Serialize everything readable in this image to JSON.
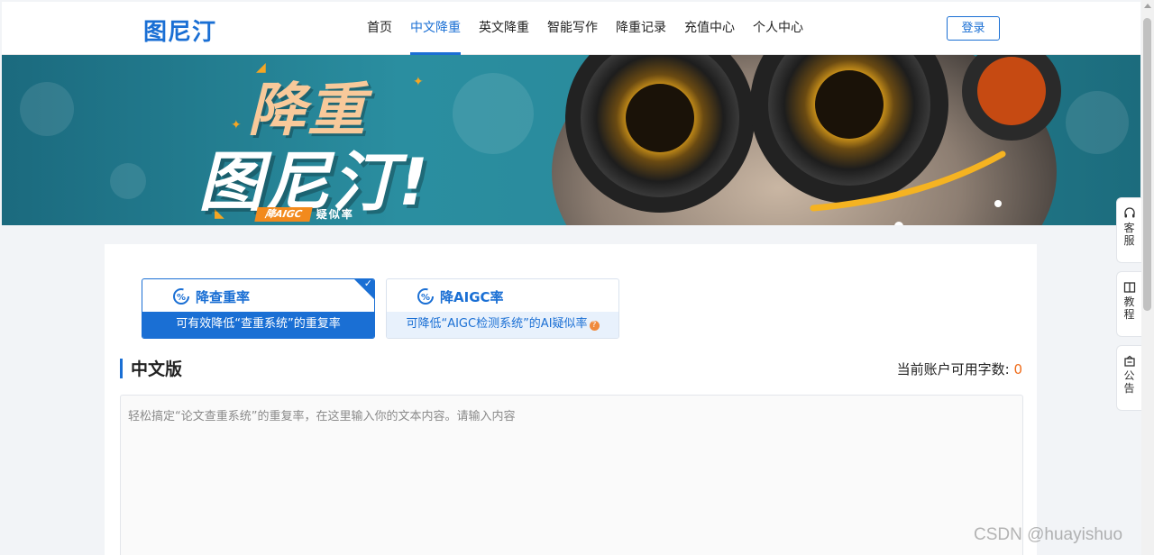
{
  "header": {
    "logo": "图尼汀",
    "nav": [
      {
        "label": "首页",
        "active": false
      },
      {
        "label": "中文降重",
        "active": true
      },
      {
        "label": "英文降重",
        "active": false
      },
      {
        "label": "智能写作",
        "active": false
      },
      {
        "label": "降重记录",
        "active": false
      },
      {
        "label": "充值中心",
        "active": false
      },
      {
        "label": "个人中心",
        "active": false
      }
    ],
    "login_label": "登录"
  },
  "banner": {
    "title_line1": "降重",
    "title_line2": "图尼汀!",
    "tag_pill": "降AIGC",
    "tag_text": "疑似率"
  },
  "mode_tabs": [
    {
      "title": "降查重率",
      "desc": "可有效降低“查重系统”的重复率",
      "selected": true
    },
    {
      "title": "降AIGC率",
      "desc": "可降低“AIGC检测系统”的AI疑似率",
      "selected": false
    }
  ],
  "section": {
    "title": "中文版",
    "credit_label": "当前账户可用字数:",
    "credit_value": "0"
  },
  "editor": {
    "placeholder": "轻松搞定“论文查重系统”的重复率，在这里输入你的文本内容。请输入内容",
    "value": ""
  },
  "side_buttons": [
    {
      "label": "客服",
      "icon": "headset-icon"
    },
    {
      "label": "教程",
      "icon": "book-icon"
    },
    {
      "label": "公告",
      "icon": "notice-icon"
    }
  ],
  "watermark": "CSDN @huayishuo",
  "colors": {
    "primary": "#1a6fd4",
    "accent": "#ef6c1a",
    "banner": "#2a8ea0"
  }
}
